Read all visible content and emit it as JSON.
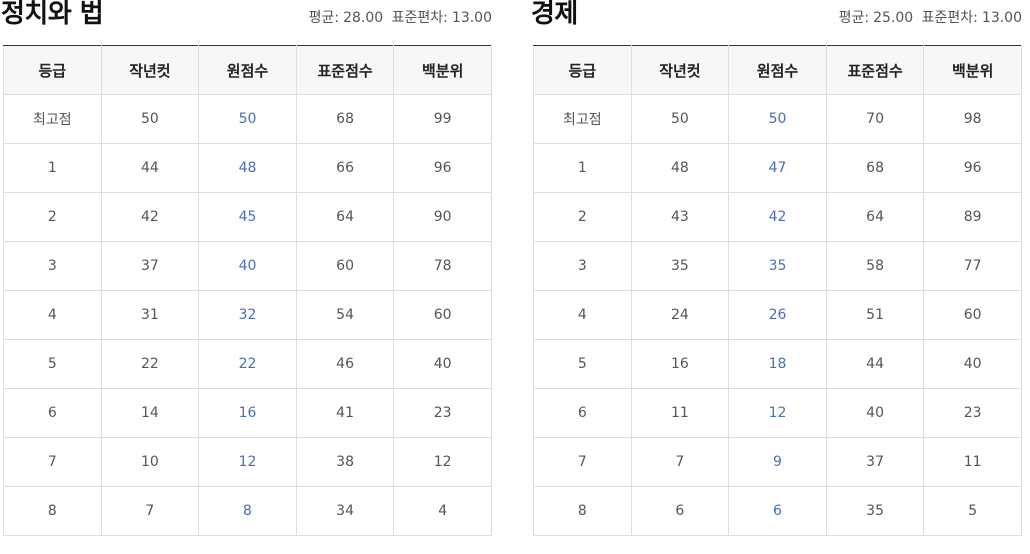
{
  "columns": [
    "등급",
    "작년컷",
    "원점수",
    "표준점수",
    "백분위"
  ],
  "colors": {
    "raw_score_text": "#4a6fb5",
    "header_background": "#f7f7f7",
    "table_top_border": "#333333",
    "cell_border": "#dddddd"
  },
  "subjects": [
    {
      "title": "정치와 법",
      "mean_label": "평균:",
      "mean": "28.00",
      "sd_label": "표준편차:",
      "sd": "13.00",
      "rows": [
        [
          "최고점",
          "50",
          "50",
          "68",
          "99"
        ],
        [
          "1",
          "44",
          "48",
          "66",
          "96"
        ],
        [
          "2",
          "42",
          "45",
          "64",
          "90"
        ],
        [
          "3",
          "37",
          "40",
          "60",
          "78"
        ],
        [
          "4",
          "31",
          "32",
          "54",
          "60"
        ],
        [
          "5",
          "22",
          "22",
          "46",
          "40"
        ],
        [
          "6",
          "14",
          "16",
          "41",
          "23"
        ],
        [
          "7",
          "10",
          "12",
          "38",
          "12"
        ],
        [
          "8",
          "7",
          "8",
          "34",
          "4"
        ]
      ]
    },
    {
      "title": "경제",
      "mean_label": "평균:",
      "mean": "25.00",
      "sd_label": "표준편차:",
      "sd": "13.00",
      "rows": [
        [
          "최고점",
          "50",
          "50",
          "70",
          "98"
        ],
        [
          "1",
          "48",
          "47",
          "68",
          "96"
        ],
        [
          "2",
          "43",
          "42",
          "64",
          "89"
        ],
        [
          "3",
          "35",
          "35",
          "58",
          "77"
        ],
        [
          "4",
          "24",
          "26",
          "51",
          "60"
        ],
        [
          "5",
          "16",
          "18",
          "44",
          "40"
        ],
        [
          "6",
          "11",
          "12",
          "40",
          "23"
        ],
        [
          "7",
          "7",
          "9",
          "37",
          "11"
        ],
        [
          "8",
          "6",
          "6",
          "35",
          "5"
        ]
      ]
    }
  ]
}
